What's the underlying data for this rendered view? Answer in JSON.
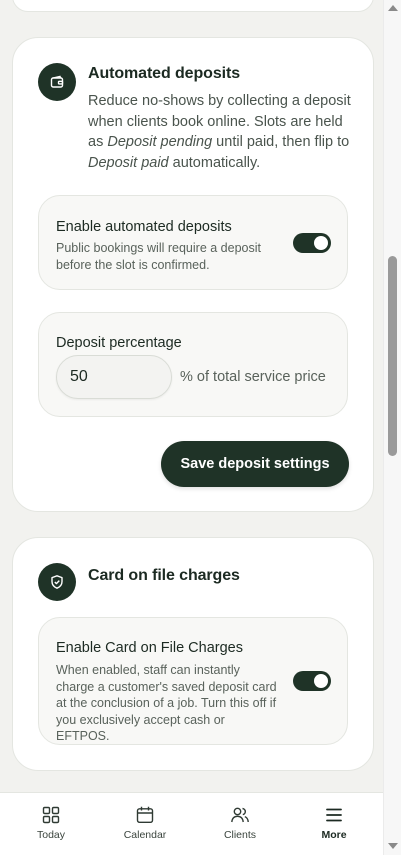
{
  "deposits": {
    "title": "Automated deposits",
    "description_part1": "Reduce no-shows by collecting a deposit when clients book online. Slots are held as ",
    "description_em1": "Deposit pending",
    "description_part2": " until paid, then flip to ",
    "description_em2": "Deposit paid",
    "description_part3": " automatically.",
    "icon": "wallet-icon",
    "enable": {
      "label": "Enable automated deposits",
      "hint": "Public bookings will require a deposit before the slot is confirmed.",
      "enabled": true
    },
    "percentage": {
      "label": "Deposit percentage",
      "value": "50",
      "suffix": "% of total service price"
    },
    "save_label": "Save deposit settings"
  },
  "card_on_file": {
    "title": "Card on file charges",
    "icon": "shield-check-icon",
    "enable": {
      "label": "Enable Card on File Charges",
      "hint": "When enabled, staff can instantly charge a customer's saved deposit card at the conclusion of a job. Turn this off if you exclusively accept cash or EFTPOS.",
      "enabled": true
    }
  },
  "nav": {
    "items": [
      {
        "label": "Today",
        "icon": "grid-icon"
      },
      {
        "label": "Calendar",
        "icon": "calendar-icon"
      },
      {
        "label": "Clients",
        "icon": "users-icon"
      },
      {
        "label": "More",
        "icon": "menu-icon",
        "active": true
      }
    ]
  },
  "colors": {
    "accent": "#1f3327",
    "background": "#f2f2ef",
    "card": "#ffffff"
  }
}
